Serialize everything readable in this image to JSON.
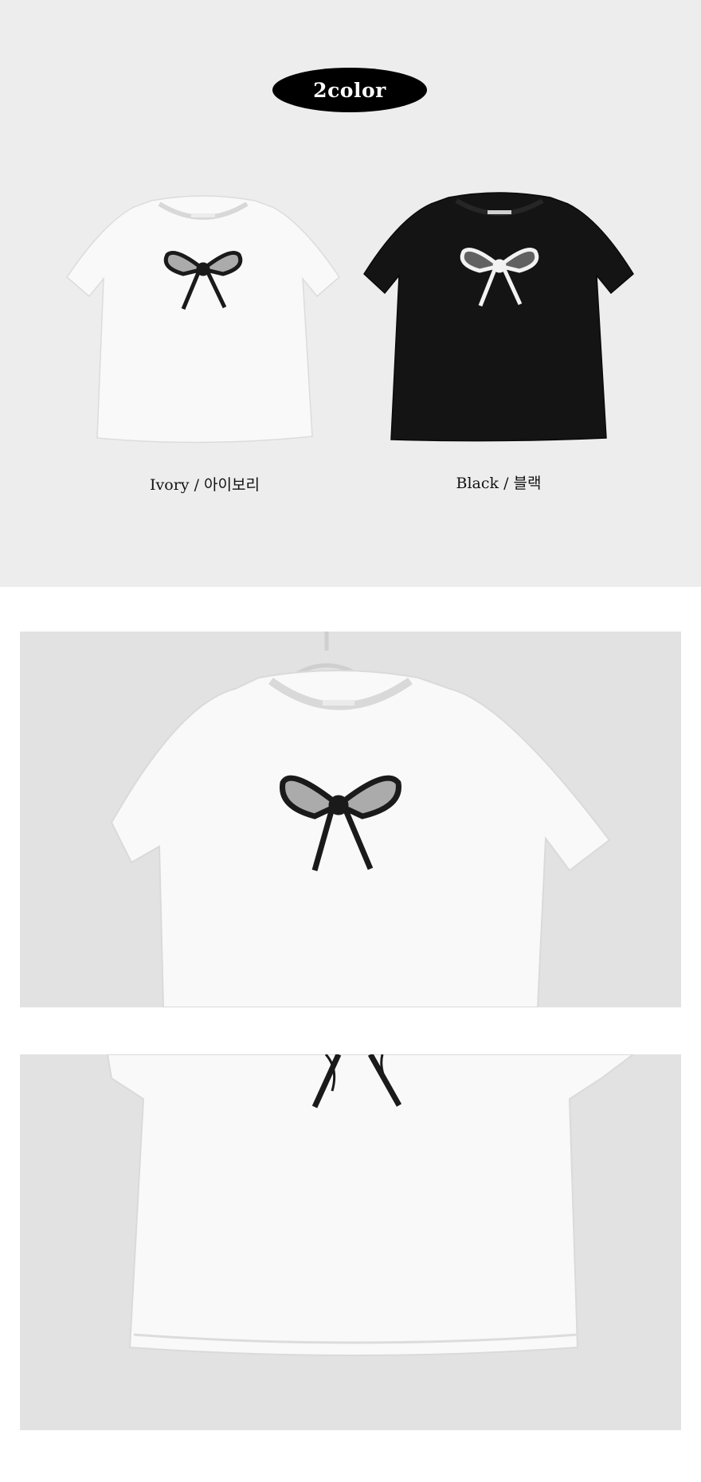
{
  "header": {
    "badge": "2color"
  },
  "colors": [
    {
      "caption": "Ivory / 아이보리",
      "shirt_color": "#f9f9f9",
      "bow_color": "#1a1a1a"
    },
    {
      "caption": "Black / 블랙",
      "shirt_color": "#141414",
      "bow_color": "#f2f2f2"
    }
  ],
  "palette": {
    "section_bg": "#ededed",
    "photo_bg": "#e2e2e2",
    "pill_bg": "#000000"
  },
  "photos": [
    {
      "label": "front-closeup-photo"
    },
    {
      "label": "body-closeup-photo"
    }
  ]
}
